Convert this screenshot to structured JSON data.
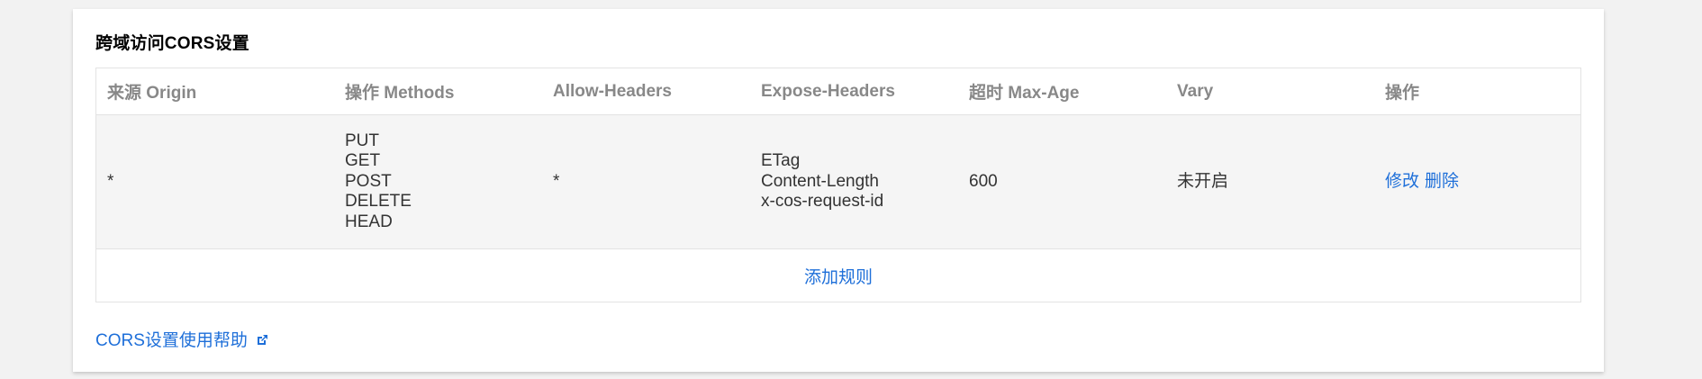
{
  "panel": {
    "title": "跨域访问CORS设置"
  },
  "table": {
    "headers": {
      "origin": "来源 Origin",
      "methods": "操作 Methods",
      "allow_headers": "Allow-Headers",
      "expose_headers": "Expose-Headers",
      "max_age": "超时 Max-Age",
      "vary": "Vary",
      "operations": "操作"
    },
    "rows": [
      {
        "origin": "*",
        "methods": [
          "PUT",
          "GET",
          "POST",
          "DELETE",
          "HEAD"
        ],
        "allow_headers": "*",
        "expose_headers": [
          "ETag",
          "Content-Length",
          "x-cos-request-id"
        ],
        "max_age": "600",
        "vary": "未开启",
        "actions": {
          "edit": "修改",
          "delete": "删除"
        }
      }
    ],
    "add_rule": "添加规则"
  },
  "help": {
    "label": "CORS设置使用帮助",
    "icon": "external-link-icon"
  },
  "colors": {
    "link": "#1e6fd9",
    "header_text": "#888888",
    "row_bg": "#f5f5f5"
  }
}
